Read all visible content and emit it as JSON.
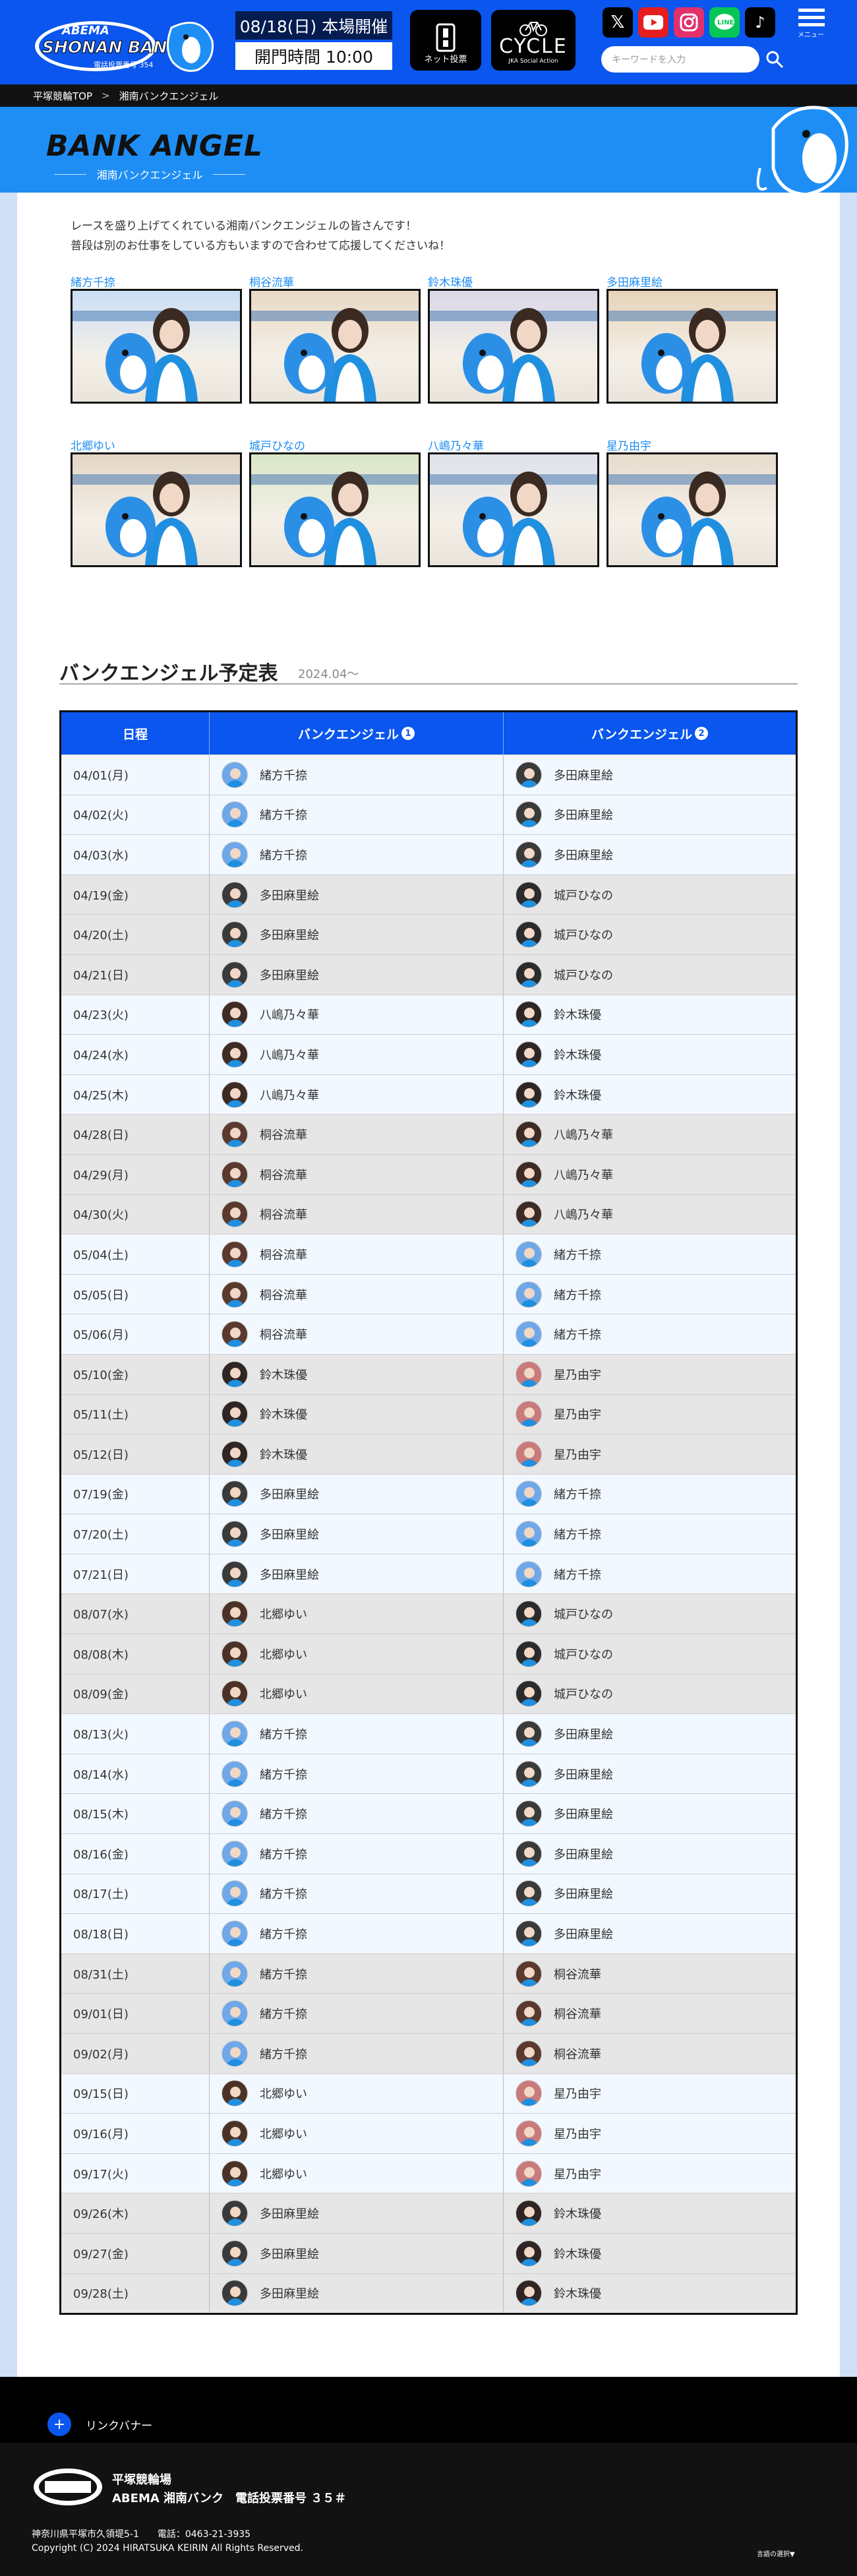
{
  "header": {
    "logo_top": "ABEMA",
    "logo_mid": "SHONAN BANK",
    "logo_sub": "電話投票番号 354",
    "date": "08/18(日) 本場開催",
    "open_time": "開門時間 10:00",
    "net_vote": "ネット投票",
    "cycle_title": "CYCLE",
    "cycle_sub": "JKA Social Action",
    "search_placeholder": "キーワードを入力",
    "menu_label": "メニュー",
    "social": [
      "x-icon",
      "youtube-icon",
      "instagram-icon",
      "line-icon",
      "tiktok-icon"
    ]
  },
  "breadcrumb": {
    "home": "平塚競輪TOP",
    "sep": ">",
    "current": "湘南バンクエンジェル"
  },
  "hero": {
    "title": "BANK ANGEL",
    "subtitle": "湘南バンクエンジェル"
  },
  "intro": {
    "line1": "レースを盛り上げてくれている湘南バンクエンジェルの皆さんです！",
    "line2": "普段は別のお仕事をしている方もいますので合わせて応援してくださいね！"
  },
  "angels": [
    "緒方千捺",
    "桐谷流華",
    "鈴木珠優",
    "多田麻里絵",
    "北郷ゆい",
    "城戸ひなの",
    "八嶋乃々華",
    "星乃由宇"
  ],
  "schedule": {
    "title": "バンクエンジェル予定表",
    "period": "2024.04〜",
    "headers": {
      "date": "日程",
      "angel1": "バンクエンジェル",
      "angel2": "バンクエンジェル",
      "n1": "1",
      "n2": "2"
    },
    "rows": [
      [
        "04/01(月)",
        "緒方千捺",
        "多田麻里絵"
      ],
      [
        "04/02(火)",
        "緒方千捺",
        "多田麻里絵"
      ],
      [
        "04/03(水)",
        "緒方千捺",
        "多田麻里絵"
      ],
      [
        "04/19(金)",
        "多田麻里絵",
        "城戸ひなの"
      ],
      [
        "04/20(土)",
        "多田麻里絵",
        "城戸ひなの"
      ],
      [
        "04/21(日)",
        "多田麻里絵",
        "城戸ひなの"
      ],
      [
        "04/23(火)",
        "八嶋乃々華",
        "鈴木珠優"
      ],
      [
        "04/24(水)",
        "八嶋乃々華",
        "鈴木珠優"
      ],
      [
        "04/25(木)",
        "八嶋乃々華",
        "鈴木珠優"
      ],
      [
        "04/28(日)",
        "桐谷流華",
        "八嶋乃々華"
      ],
      [
        "04/29(月)",
        "桐谷流華",
        "八嶋乃々華"
      ],
      [
        "04/30(火)",
        "桐谷流華",
        "八嶋乃々華"
      ],
      [
        "05/04(土)",
        "桐谷流華",
        "緒方千捺"
      ],
      [
        "05/05(日)",
        "桐谷流華",
        "緒方千捺"
      ],
      [
        "05/06(月)",
        "桐谷流華",
        "緒方千捺"
      ],
      [
        "05/10(金)",
        "鈴木珠優",
        "星乃由宇"
      ],
      [
        "05/11(土)",
        "鈴木珠優",
        "星乃由宇"
      ],
      [
        "05/12(日)",
        "鈴木珠優",
        "星乃由宇"
      ],
      [
        "07/19(金)",
        "多田麻里絵",
        "緒方千捺"
      ],
      [
        "07/20(土)",
        "多田麻里絵",
        "緒方千捺"
      ],
      [
        "07/21(日)",
        "多田麻里絵",
        "緒方千捺"
      ],
      [
        "08/07(水)",
        "北郷ゆい",
        "城戸ひなの"
      ],
      [
        "08/08(木)",
        "北郷ゆい",
        "城戸ひなの"
      ],
      [
        "08/09(金)",
        "北郷ゆい",
        "城戸ひなの"
      ],
      [
        "08/13(火)",
        "緒方千捺",
        "多田麻里絵"
      ],
      [
        "08/14(水)",
        "緒方千捺",
        "多田麻里絵"
      ],
      [
        "08/15(木)",
        "緒方千捺",
        "多田麻里絵"
      ],
      [
        "08/16(金)",
        "緒方千捺",
        "多田麻里絵"
      ],
      [
        "08/17(土)",
        "緒方千捺",
        "多田麻里絵"
      ],
      [
        "08/18(日)",
        "緒方千捺",
        "多田麻里絵"
      ],
      [
        "08/31(土)",
        "緒方千捺",
        "桐谷流華"
      ],
      [
        "09/01(日)",
        "緒方千捺",
        "桐谷流華"
      ],
      [
        "09/02(月)",
        "緒方千捺",
        "桐谷流華"
      ],
      [
        "09/15(日)",
        "北郷ゆい",
        "星乃由宇"
      ],
      [
        "09/16(月)",
        "北郷ゆい",
        "星乃由宇"
      ],
      [
        "09/17(火)",
        "北郷ゆい",
        "星乃由宇"
      ],
      [
        "09/26(木)",
        "多田麻里絵",
        "鈴木珠優"
      ],
      [
        "09/27(金)",
        "多田麻里絵",
        "鈴木珠優"
      ],
      [
        "09/28(土)",
        "多田麻里絵",
        "鈴木珠優"
      ]
    ]
  },
  "footer": {
    "link_banner": "リンクバナー",
    "name1": "平塚競輪場",
    "name2": "ABEMA 湘南バンク　電話投票番号 ３５＃",
    "address": "神奈川県平塚市久領堤5-1　　電話：0463-21-3935",
    "copyright": "Copyright (C) 2024 HIRATSUKA KEIRIN All Rights Reserved.",
    "lang": "言語の選択▼"
  },
  "colors": {
    "brand_blue": "#0a56ee",
    "hero_blue": "#1e8ef5",
    "name_blue": "#1e8ef5",
    "dark": "#121212"
  }
}
